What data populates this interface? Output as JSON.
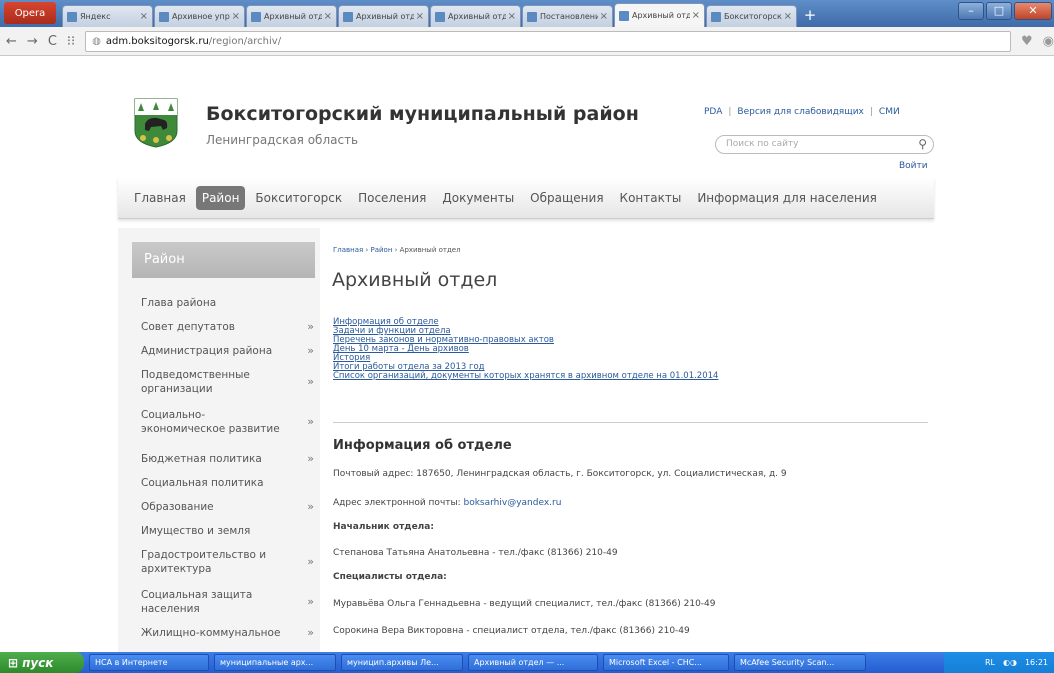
{
  "browser": {
    "opera_label": "Opera",
    "tabs": [
      {
        "label": "Яндекс",
        "active": false
      },
      {
        "label": "Архивное упра",
        "active": false
      },
      {
        "label": "Архивный отде",
        "active": false
      },
      {
        "label": "Архивный отде",
        "active": false
      },
      {
        "label": "Архивный отде",
        "active": false
      },
      {
        "label": "Постановление",
        "active": false
      },
      {
        "label": "Архивный отде",
        "active": true
      },
      {
        "label": "Бокситогорск",
        "active": false
      }
    ],
    "url_host": "adm.boksitogorsk.ru",
    "url_path": "/region/archiv/"
  },
  "header": {
    "title": "Бокситогорский муниципальный район",
    "subtitle": "Ленинградская область",
    "links": [
      "PDA",
      "Версия для слабовидящих",
      "СМИ"
    ],
    "search_placeholder": "Поиск по сайту",
    "login": "Войти"
  },
  "nav": {
    "items": [
      "Главная",
      "Район",
      "Бокситогорск",
      "Поселения",
      "Документы",
      "Обращения",
      "Контакты",
      "Информация для населения"
    ],
    "active": 1
  },
  "sidebar": {
    "title": "Район",
    "items": [
      {
        "label": "Глава района",
        "arrow": false
      },
      {
        "label": "Совет депутатов",
        "arrow": true
      },
      {
        "label": "Администрация района",
        "arrow": true
      },
      {
        "label": "Подведомственные организации",
        "arrow": true
      },
      {
        "label": "Социально-экономическое развитие",
        "arrow": true
      },
      {
        "label": "Бюджетная политика",
        "arrow": true
      },
      {
        "label": "Социальная политика",
        "arrow": false
      },
      {
        "label": "Образование",
        "arrow": true
      },
      {
        "label": "Имущество и земля",
        "arrow": false
      },
      {
        "label": "Градостроительство и архитектура",
        "arrow": true
      },
      {
        "label": "Социальная защита населения",
        "arrow": true
      },
      {
        "label": "Жилищно-коммунальное",
        "arrow": true
      }
    ]
  },
  "main": {
    "breadcrumb": [
      "Главная",
      "Район",
      "Архивный отдел"
    ],
    "title": "Архивный отдел",
    "links": [
      "Информация об отделе",
      "Задачи и функции отдела",
      "Перечень законов и нормативно-правовых актов",
      "День 10 марта - День архивов",
      "История",
      "Итоги работы отдела за 2013 год",
      "Список организаций, документы которых хранятся в архивном отделе на 01.01.2014"
    ],
    "section_title": "Информация об отделе",
    "address": "Почтовый адрес: 187650, Ленинградская область, г. Бокситогорск, ул. Социалистическая, д. 9",
    "email_label": "Адрес электронной почты: ",
    "email": "boksarhiv@yandex.ru",
    "head_label": "Начальник отдела:",
    "head": "Степанова Татьяна Анатольевна - тел./факс (81366) 210-49",
    "specialists_label": "Специалисты отдела:",
    "specialist1": "Муравьёва Ольга Геннадьевна - ведущий специалист, тел./факс (81366) 210-49",
    "specialist2": "Сорокина Вера Викторовна - специалист отдела, тел./факс (81366) 210-49"
  },
  "taskbar": {
    "start": "пуск",
    "items": [
      "НСА в Интернете",
      "муниципальные арх...",
      "муницип.архивы Ле...",
      "Архивный отдел — ...",
      "Microsoft Excel - CHC...",
      "McAfee Security Scan..."
    ],
    "lang": "RL",
    "time": "16:21"
  },
  "colors": {
    "link": "#2a5a9c",
    "nav_active": "#777777",
    "titlebar": "#4a78b6"
  }
}
